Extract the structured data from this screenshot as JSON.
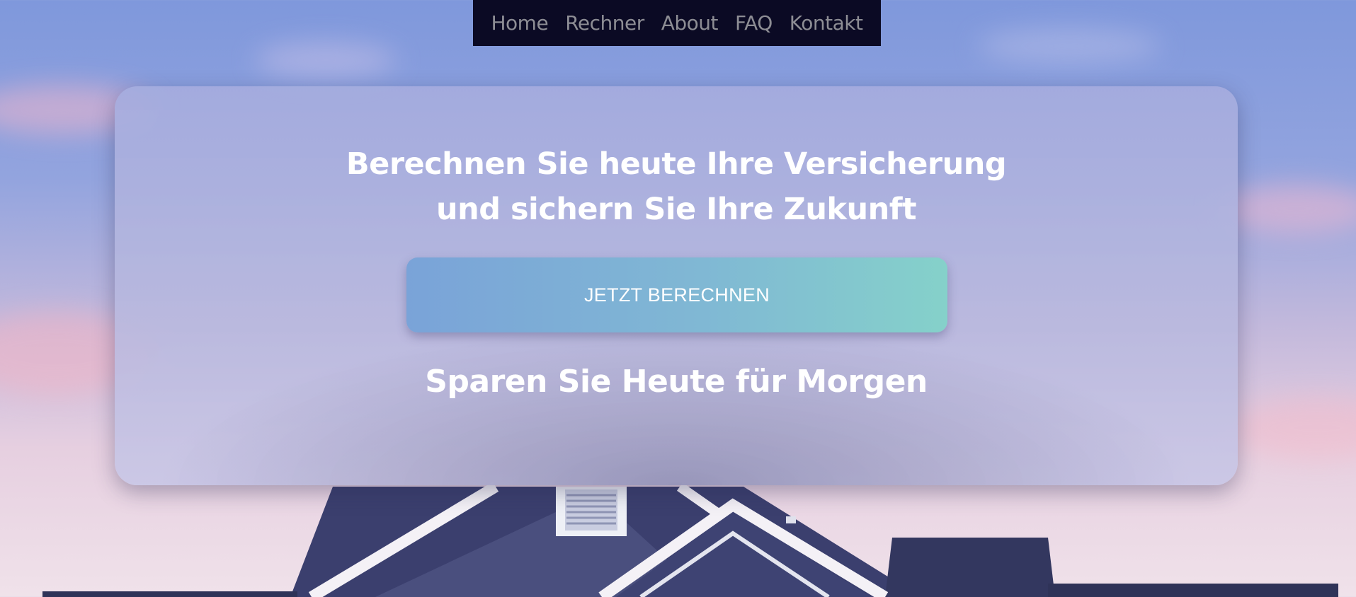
{
  "nav": {
    "items": [
      {
        "label": "Home"
      },
      {
        "label": "Rechner"
      },
      {
        "label": "About"
      },
      {
        "label": "FAQ"
      },
      {
        "label": "Kontakt"
      }
    ]
  },
  "hero": {
    "headline_line1": "Berechnen Sie heute Ihre Versicherung",
    "headline_line2": "und sichern Sie Ihre Zukunft",
    "cta_label": "JETZT BERECHNEN",
    "subline": "Sparen Sie Heute für Morgen"
  },
  "colors": {
    "nav_background": "#0b0a24",
    "nav_text": "#8d8d94",
    "cta_gradient_start": "#7aa3d8",
    "cta_gradient_end": "#85d1ca",
    "house": "#3b3f6e"
  }
}
